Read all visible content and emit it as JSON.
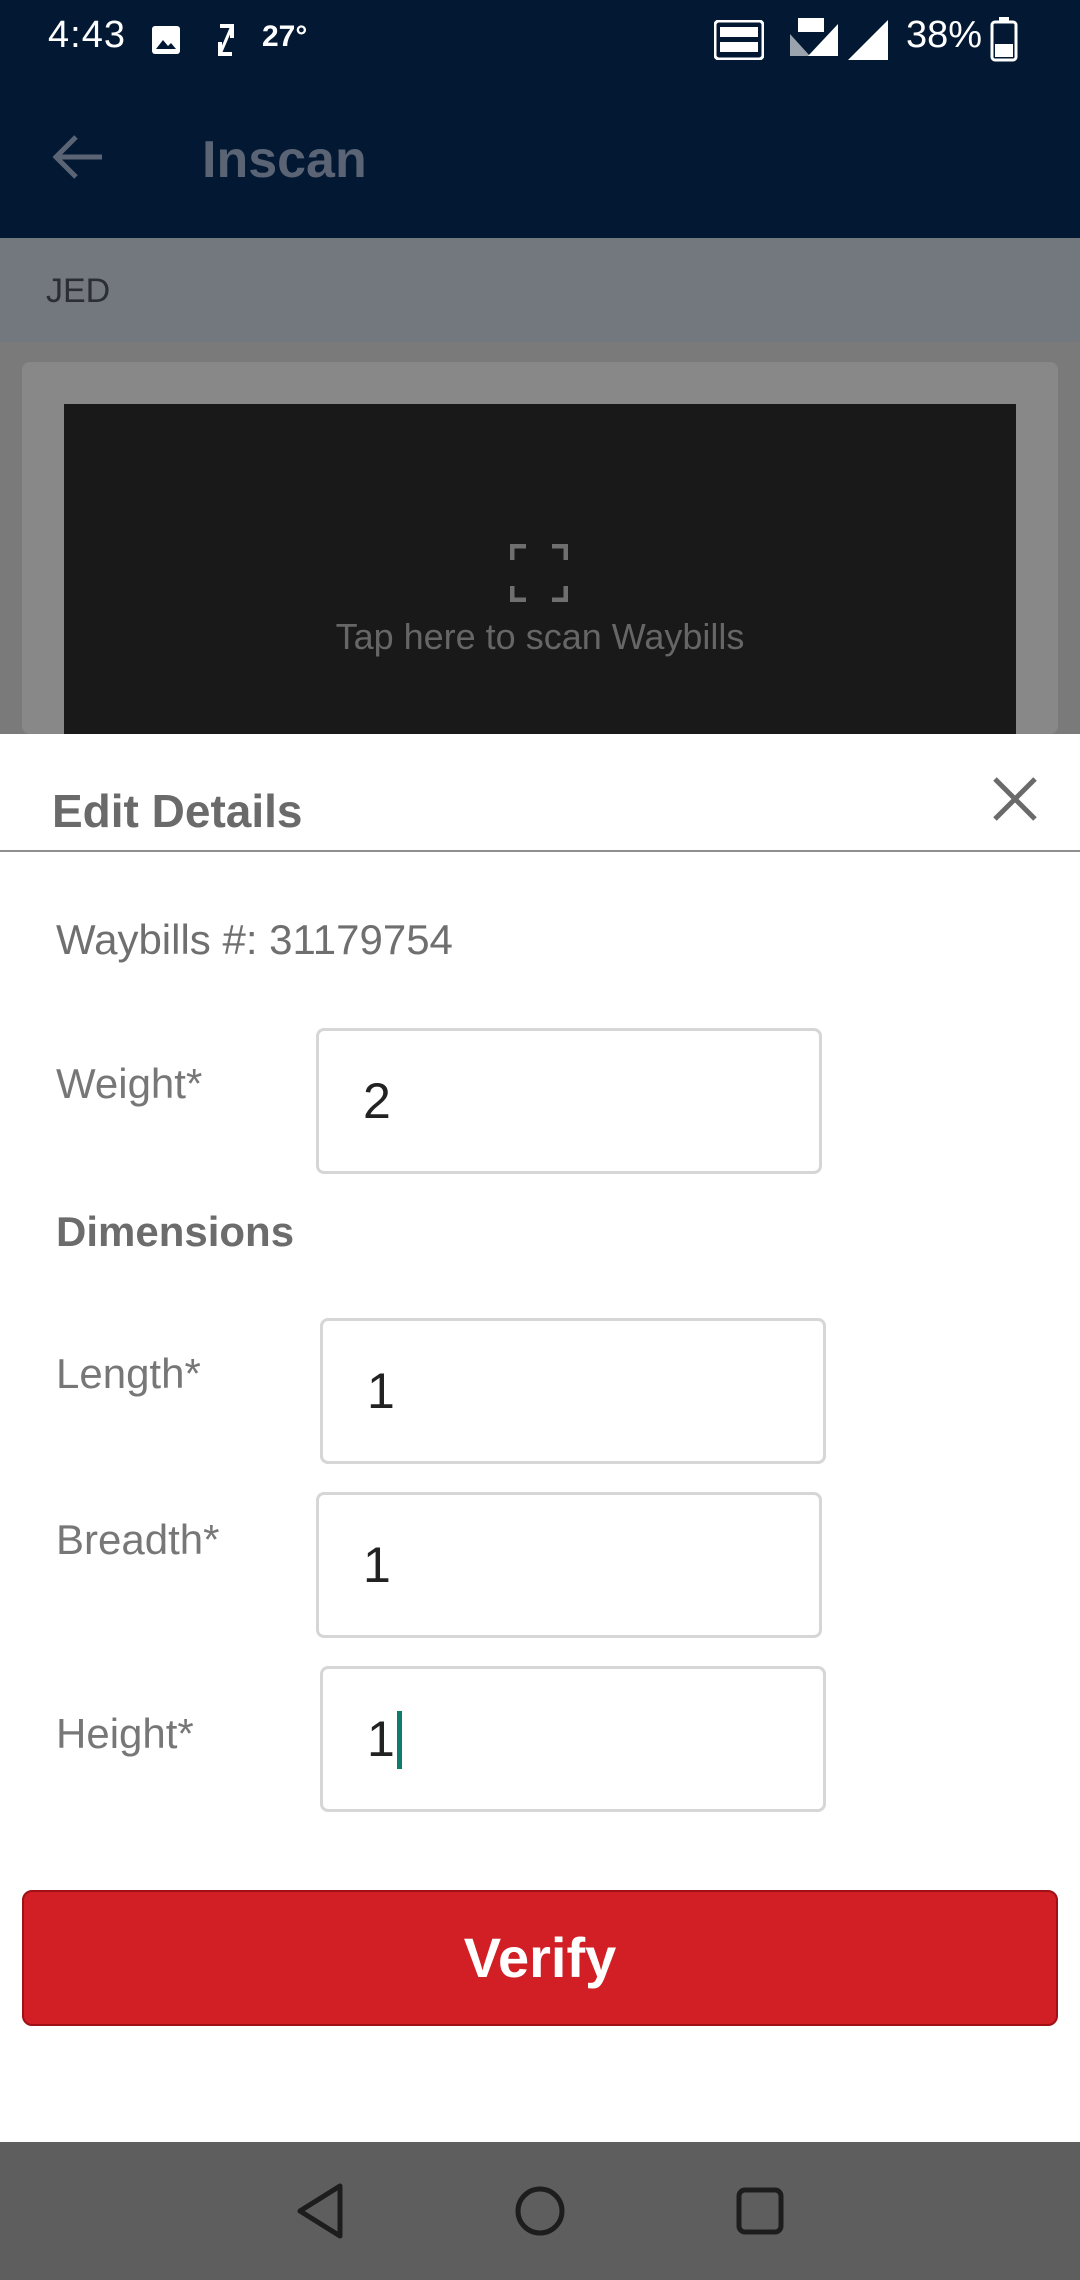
{
  "status_bar": {
    "time": "4:43",
    "temperature": "27°",
    "battery": "38%",
    "icons": [
      "gallery-icon",
      "sync-icon",
      "volte-icon",
      "4g-icon",
      "signal-icon",
      "battery-icon"
    ]
  },
  "app_bar": {
    "title": "Inscan",
    "back_icon": "arrow-left-icon"
  },
  "location": {
    "label": "JED"
  },
  "scan": {
    "label": "Tap here to scan Waybills",
    "icon": "scan-frame-icon"
  },
  "sheet": {
    "title": "Edit Details",
    "close_icon": "close-icon",
    "waybill_line": "Waybills #: 31179754",
    "weight": {
      "label": "Weight*",
      "value": "2"
    },
    "dimensions_label": "Dimensions",
    "length": {
      "label": "Length*",
      "value": "1"
    },
    "breadth": {
      "label": "Breadth*",
      "value": "1"
    },
    "height": {
      "label": "Height*",
      "value": "1"
    },
    "verify_label": "Verify"
  },
  "colors": {
    "app_bar_bg": "#021833",
    "verify_bg": "#d11f25",
    "caret": "#0e7b6d"
  },
  "nav_bar": {
    "icons": [
      "back-triangle-icon",
      "home-circle-icon",
      "recents-square-icon"
    ]
  }
}
